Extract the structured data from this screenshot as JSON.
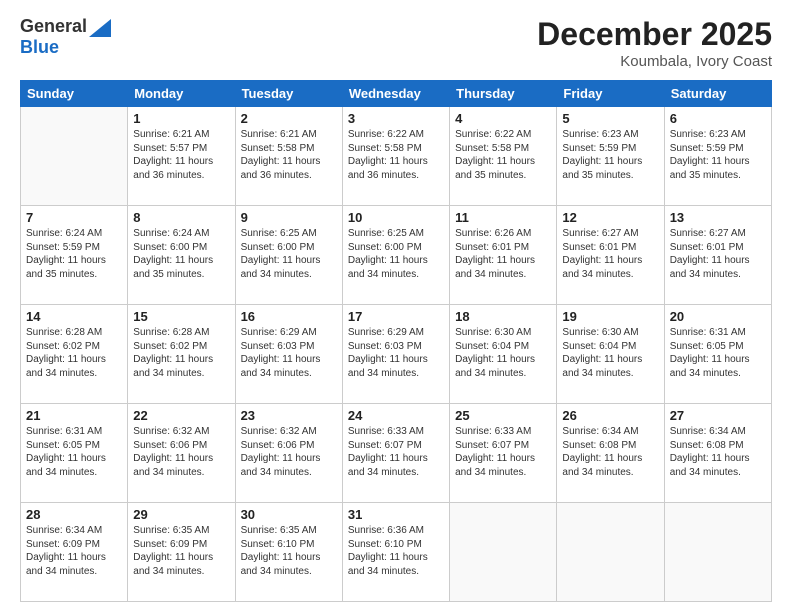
{
  "header": {
    "logo_general": "General",
    "logo_blue": "Blue",
    "month_title": "December 2025",
    "location": "Koumbala, Ivory Coast"
  },
  "days": [
    "Sunday",
    "Monday",
    "Tuesday",
    "Wednesday",
    "Thursday",
    "Friday",
    "Saturday"
  ],
  "weeks": [
    [
      {
        "num": "",
        "sr": "",
        "ss": "",
        "dl": ""
      },
      {
        "num": "1",
        "sr": "Sunrise: 6:21 AM",
        "ss": "Sunset: 5:57 PM",
        "dl": "Daylight: 11 hours and 36 minutes."
      },
      {
        "num": "2",
        "sr": "Sunrise: 6:21 AM",
        "ss": "Sunset: 5:58 PM",
        "dl": "Daylight: 11 hours and 36 minutes."
      },
      {
        "num": "3",
        "sr": "Sunrise: 6:22 AM",
        "ss": "Sunset: 5:58 PM",
        "dl": "Daylight: 11 hours and 36 minutes."
      },
      {
        "num": "4",
        "sr": "Sunrise: 6:22 AM",
        "ss": "Sunset: 5:58 PM",
        "dl": "Daylight: 11 hours and 35 minutes."
      },
      {
        "num": "5",
        "sr": "Sunrise: 6:23 AM",
        "ss": "Sunset: 5:59 PM",
        "dl": "Daylight: 11 hours and 35 minutes."
      },
      {
        "num": "6",
        "sr": "Sunrise: 6:23 AM",
        "ss": "Sunset: 5:59 PM",
        "dl": "Daylight: 11 hours and 35 minutes."
      }
    ],
    [
      {
        "num": "7",
        "sr": "Sunrise: 6:24 AM",
        "ss": "Sunset: 5:59 PM",
        "dl": "Daylight: 11 hours and 35 minutes."
      },
      {
        "num": "8",
        "sr": "Sunrise: 6:24 AM",
        "ss": "Sunset: 6:00 PM",
        "dl": "Daylight: 11 hours and 35 minutes."
      },
      {
        "num": "9",
        "sr": "Sunrise: 6:25 AM",
        "ss": "Sunset: 6:00 PM",
        "dl": "Daylight: 11 hours and 34 minutes."
      },
      {
        "num": "10",
        "sr": "Sunrise: 6:25 AM",
        "ss": "Sunset: 6:00 PM",
        "dl": "Daylight: 11 hours and 34 minutes."
      },
      {
        "num": "11",
        "sr": "Sunrise: 6:26 AM",
        "ss": "Sunset: 6:01 PM",
        "dl": "Daylight: 11 hours and 34 minutes."
      },
      {
        "num": "12",
        "sr": "Sunrise: 6:27 AM",
        "ss": "Sunset: 6:01 PM",
        "dl": "Daylight: 11 hours and 34 minutes."
      },
      {
        "num": "13",
        "sr": "Sunrise: 6:27 AM",
        "ss": "Sunset: 6:01 PM",
        "dl": "Daylight: 11 hours and 34 minutes."
      }
    ],
    [
      {
        "num": "14",
        "sr": "Sunrise: 6:28 AM",
        "ss": "Sunset: 6:02 PM",
        "dl": "Daylight: 11 hours and 34 minutes."
      },
      {
        "num": "15",
        "sr": "Sunrise: 6:28 AM",
        "ss": "Sunset: 6:02 PM",
        "dl": "Daylight: 11 hours and 34 minutes."
      },
      {
        "num": "16",
        "sr": "Sunrise: 6:29 AM",
        "ss": "Sunset: 6:03 PM",
        "dl": "Daylight: 11 hours and 34 minutes."
      },
      {
        "num": "17",
        "sr": "Sunrise: 6:29 AM",
        "ss": "Sunset: 6:03 PM",
        "dl": "Daylight: 11 hours and 34 minutes."
      },
      {
        "num": "18",
        "sr": "Sunrise: 6:30 AM",
        "ss": "Sunset: 6:04 PM",
        "dl": "Daylight: 11 hours and 34 minutes."
      },
      {
        "num": "19",
        "sr": "Sunrise: 6:30 AM",
        "ss": "Sunset: 6:04 PM",
        "dl": "Daylight: 11 hours and 34 minutes."
      },
      {
        "num": "20",
        "sr": "Sunrise: 6:31 AM",
        "ss": "Sunset: 6:05 PM",
        "dl": "Daylight: 11 hours and 34 minutes."
      }
    ],
    [
      {
        "num": "21",
        "sr": "Sunrise: 6:31 AM",
        "ss": "Sunset: 6:05 PM",
        "dl": "Daylight: 11 hours and 34 minutes."
      },
      {
        "num": "22",
        "sr": "Sunrise: 6:32 AM",
        "ss": "Sunset: 6:06 PM",
        "dl": "Daylight: 11 hours and 34 minutes."
      },
      {
        "num": "23",
        "sr": "Sunrise: 6:32 AM",
        "ss": "Sunset: 6:06 PM",
        "dl": "Daylight: 11 hours and 34 minutes."
      },
      {
        "num": "24",
        "sr": "Sunrise: 6:33 AM",
        "ss": "Sunset: 6:07 PM",
        "dl": "Daylight: 11 hours and 34 minutes."
      },
      {
        "num": "25",
        "sr": "Sunrise: 6:33 AM",
        "ss": "Sunset: 6:07 PM",
        "dl": "Daylight: 11 hours and 34 minutes."
      },
      {
        "num": "26",
        "sr": "Sunrise: 6:34 AM",
        "ss": "Sunset: 6:08 PM",
        "dl": "Daylight: 11 hours and 34 minutes."
      },
      {
        "num": "27",
        "sr": "Sunrise: 6:34 AM",
        "ss": "Sunset: 6:08 PM",
        "dl": "Daylight: 11 hours and 34 minutes."
      }
    ],
    [
      {
        "num": "28",
        "sr": "Sunrise: 6:34 AM",
        "ss": "Sunset: 6:09 PM",
        "dl": "Daylight: 11 hours and 34 minutes."
      },
      {
        "num": "29",
        "sr": "Sunrise: 6:35 AM",
        "ss": "Sunset: 6:09 PM",
        "dl": "Daylight: 11 hours and 34 minutes."
      },
      {
        "num": "30",
        "sr": "Sunrise: 6:35 AM",
        "ss": "Sunset: 6:10 PM",
        "dl": "Daylight: 11 hours and 34 minutes."
      },
      {
        "num": "31",
        "sr": "Sunrise: 6:36 AM",
        "ss": "Sunset: 6:10 PM",
        "dl": "Daylight: 11 hours and 34 minutes."
      },
      {
        "num": "",
        "sr": "",
        "ss": "",
        "dl": ""
      },
      {
        "num": "",
        "sr": "",
        "ss": "",
        "dl": ""
      },
      {
        "num": "",
        "sr": "",
        "ss": "",
        "dl": ""
      }
    ]
  ]
}
